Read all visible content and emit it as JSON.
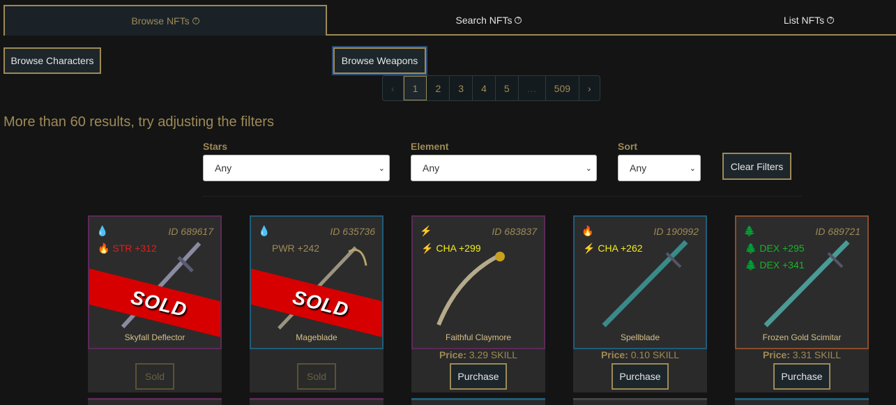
{
  "tabs": [
    {
      "label": "Browse NFTs",
      "icon": "question-icon"
    },
    {
      "label": "Search NFTs",
      "icon": "question-icon"
    },
    {
      "label": "List NFTs",
      "icon": "question-icon"
    }
  ],
  "browse_characters_label": "Browse Characters",
  "browse_weapons_label": "Browse Weapons",
  "pagination": {
    "prev": "‹",
    "pages": [
      "1",
      "2",
      "3",
      "4",
      "5",
      "…",
      "509"
    ],
    "next": "›",
    "current": "1"
  },
  "results_text": "More than 60 results, try adjusting the filters",
  "filters": {
    "stars": {
      "label": "Stars",
      "value": "Any"
    },
    "element": {
      "label": "Element",
      "value": "Any"
    },
    "sort": {
      "label": "Sort",
      "value": "Any"
    },
    "clear_label": "Clear Filters"
  },
  "colors": {
    "gold": "#9e8a57",
    "purple": "#5c2a57",
    "blue": "#1f5d78",
    "orange": "#8a4e2a",
    "fire": "#e01e1e",
    "water": "#22d0e8",
    "lightning": "#f2ee1e",
    "earth": "#17b52a"
  },
  "cards": [
    {
      "id": "ID 689617",
      "element": "water-drop-icon",
      "stats": [
        {
          "icon": "fire-icon",
          "text": "STR +312",
          "color": "#e01e1e"
        }
      ],
      "name": "Skyfall Deflector",
      "sold": true,
      "sold_label": "SOLD",
      "button": "Sold",
      "border": "#5c2a57"
    },
    {
      "id": "ID 635736",
      "element": "water-drop-icon",
      "stats": [
        {
          "icon": "",
          "text": "PWR +242",
          "color": "#9e8a57"
        }
      ],
      "name": "Mageblade",
      "sold": true,
      "sold_label": "SOLD",
      "button": "Sold",
      "border": "#1f5d78"
    },
    {
      "id": "ID 683837",
      "element": "lightning-icon",
      "stats": [
        {
          "icon": "lightning-icon",
          "text": "CHA +299",
          "color": "#f2ee1e"
        }
      ],
      "name": "Faithful Claymore",
      "sold": false,
      "price_label": "Price:",
      "price": "3.29 SKILL",
      "button": "Purchase",
      "border": "#5c2a57"
    },
    {
      "id": "ID 190992",
      "element": "fire-icon",
      "stats": [
        {
          "icon": "lightning-icon",
          "text": "CHA +262",
          "color": "#f2ee1e"
        }
      ],
      "name": "Spellblade",
      "sold": false,
      "price_label": "Price:",
      "price": "0.10 SKILL",
      "button": "Purchase",
      "border": "#1f5d78"
    },
    {
      "id": "ID 689721",
      "element": "tree-icon",
      "stats": [
        {
          "icon": "tree-icon",
          "text": "DEX +295",
          "color": "#17b52a"
        },
        {
          "icon": "tree-icon",
          "text": "DEX +341",
          "color": "#17b52a"
        }
      ],
      "name": "Frozen Gold Scimitar",
      "sold": false,
      "price_label": "Price:",
      "price": "3.31 SKILL",
      "button": "Purchase",
      "border": "#8a4e2a"
    }
  ]
}
